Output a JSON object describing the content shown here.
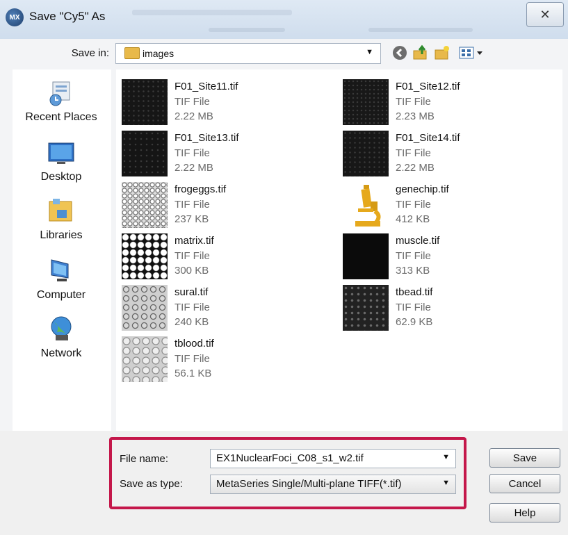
{
  "window": {
    "title": "Save \"Cy5\" As",
    "app_badge": "MX",
    "close_glyph": "✕"
  },
  "toolbar": {
    "save_in_label": "Save in:",
    "location": "images"
  },
  "places": [
    {
      "label": "Recent Places",
      "icon": "recent-places-icon"
    },
    {
      "label": "Desktop",
      "icon": "desktop-icon"
    },
    {
      "label": "Libraries",
      "icon": "libraries-icon"
    },
    {
      "label": "Computer",
      "icon": "computer-icon"
    },
    {
      "label": "Network",
      "icon": "network-icon"
    }
  ],
  "files": [
    {
      "name": "F01_Site11.tif",
      "type": "TIF File",
      "size": "2.22 MB",
      "thumb": "dark-noise"
    },
    {
      "name": "F01_Site12.tif",
      "type": "TIF File",
      "size": "2.23 MB",
      "thumb": "dark-noise"
    },
    {
      "name": "F01_Site13.tif",
      "type": "TIF File",
      "size": "2.22 MB",
      "thumb": "dark-noise"
    },
    {
      "name": "F01_Site14.tif",
      "type": "TIF File",
      "size": "2.22 MB",
      "thumb": "dark-noise"
    },
    {
      "name": "frogeggs.tif",
      "type": "TIF File",
      "size": "237 KB",
      "thumb": "frogeggs"
    },
    {
      "name": "genechip.tif",
      "type": "TIF File",
      "size": "412 KB",
      "thumb": "microscope-icon"
    },
    {
      "name": "matrix.tif",
      "type": "TIF File",
      "size": "300 KB",
      "thumb": "dot-matrix"
    },
    {
      "name": "muscle.tif",
      "type": "TIF File",
      "size": "313 KB",
      "thumb": "black"
    },
    {
      "name": "sural.tif",
      "type": "TIF File",
      "size": "240 KB",
      "thumb": "rings"
    },
    {
      "name": "tbead.tif",
      "type": "TIF File",
      "size": "62.9 KB",
      "thumb": "beads"
    },
    {
      "name": "tblood.tif",
      "type": "TIF File",
      "size": "56.1 KB",
      "thumb": "blood"
    }
  ],
  "form": {
    "file_name_label": "File name:",
    "file_name_value": "EX1NuclearFoci_C08_s1_w2.tif",
    "save_as_type_label": "Save as type:",
    "save_as_type_value": "MetaSeries Single/Multi-plane TIFF(*.tif)"
  },
  "buttons": {
    "save": "Save",
    "cancel": "Cancel",
    "help": "Help"
  },
  "colors": {
    "highlight": "#c4174a",
    "folder": "#e8b94a",
    "secondary_text": "#6b6b6b"
  }
}
